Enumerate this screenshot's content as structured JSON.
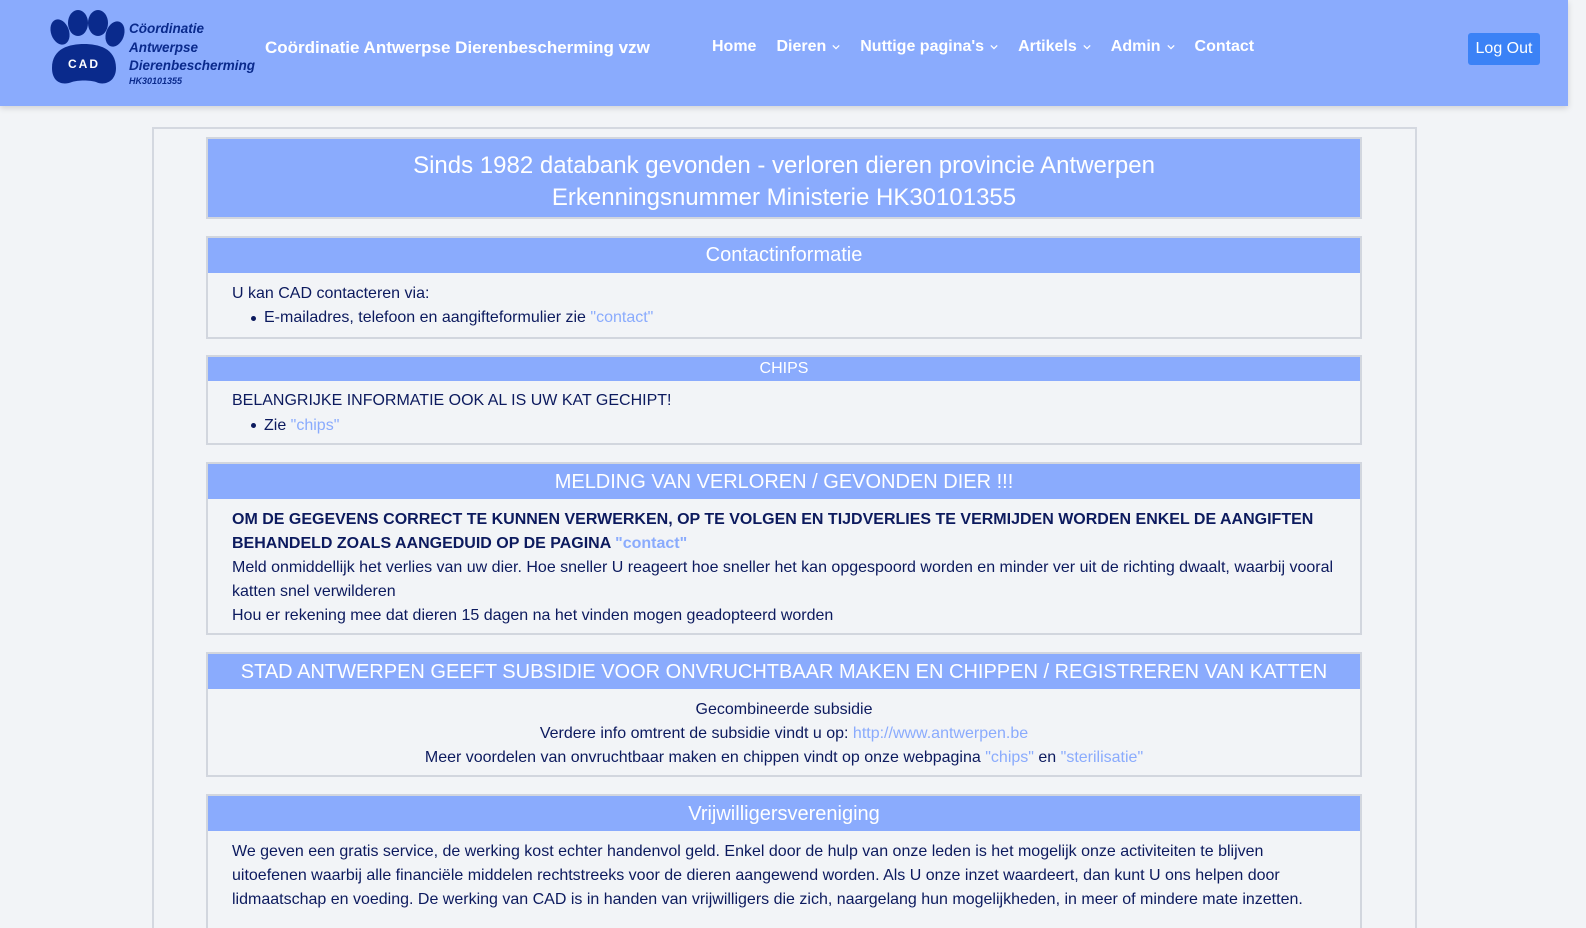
{
  "header": {
    "logo": {
      "badge": "CAD",
      "lines": [
        "Cöordinatie",
        "Antwerpse",
        "Dierenbescherming"
      ],
      "registration": "HK30101355"
    },
    "site_title": "Coördinatie Antwerpse Dierenbescherming vzw",
    "nav": [
      {
        "label": "Home",
        "dropdown": false
      },
      {
        "label": "Dieren",
        "dropdown": true
      },
      {
        "label": "Nuttige pagina's",
        "dropdown": true
      },
      {
        "label": "Artikels",
        "dropdown": true
      },
      {
        "label": "Admin",
        "dropdown": true
      },
      {
        "label": "Contact",
        "dropdown": false
      }
    ],
    "logout_label": "Log Out"
  },
  "banner": {
    "line1": "Sinds 1982 databank gevonden - verloren dieren provincie Antwerpen",
    "line2": "Erkenningsnummer Ministerie HK30101355"
  },
  "contact": {
    "title": "Contactinformatie",
    "intro": "U kan CAD contacteren via:",
    "item_text": "E-mailadres, telefoon en aangifteformulier zie ",
    "item_link": "\"contact\""
  },
  "chips": {
    "title": "CHIPS",
    "intro": "BELANGRIJKE INFORMATIE OOK AL IS UW KAT GECHIPT!",
    "item_text": "Zie ",
    "item_link": "\"chips\""
  },
  "melding": {
    "title": "MELDING VAN VERLOREN / GEVONDEN DIER !!!",
    "bold_text": "OM DE GEGEVENS CORRECT TE KUNNEN VERWERKEN, OP TE VOLGEN EN TIJDVERLIES TE VERMIJDEN WORDEN ENKEL DE AANGIFTEN BEHANDELD ZOALS AANGEDUID OP DE PAGINA ",
    "bold_link": "\"contact\"",
    "para1": "Meld onmiddellijk het verlies van uw dier. Hoe sneller U reageert hoe sneller het kan opgespoord worden en minder ver uit de richting dwaalt, waarbij vooral katten snel verwilderen",
    "para2": "Hou er rekening mee dat dieren 15 dagen na het vinden mogen geadopteerd worden"
  },
  "subsidie": {
    "title": "STAD ANTWERPEN GEEFT SUBSIDIE VOOR ONVRUCHTBAAR MAKEN EN CHIPPEN / REGISTREREN VAN KATTEN",
    "line1": "Gecombineerde subsidie",
    "line2_text": "Verdere info omtrent de subsidie vindt u op: ",
    "line2_link": "http://www.antwerpen.be",
    "line3_text": "Meer voordelen van onvruchtbaar maken en chippen vindt op onze webpagina ",
    "line3_link1": "\"chips\"",
    "line3_mid": " en ",
    "line3_link2": "\"sterilisatie\""
  },
  "vrijwilligers": {
    "title": "Vrijwilligersvereniging",
    "text": "We geven een gratis service, de werking kost echter handenvol geld. Enkel door de hulp van onze leden is het mogelijk onze activiteiten te blijven uitoefenen waarbij alle financiële middelen rechtstreeks voor de dieren aangewend worden. Als U onze inzet waardeert, dan kunt U ons helpen door lidmaatschap en voeding. De werking van CAD is in handen van vrijwilligers die zich, naargelang hun mogelijkheden, in meer of mindere mate inzetten."
  }
}
